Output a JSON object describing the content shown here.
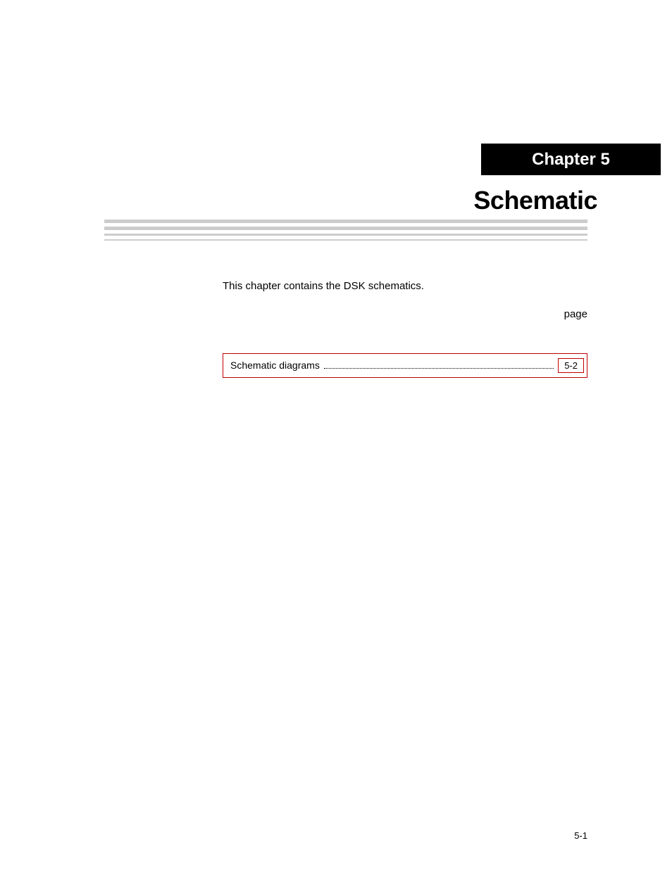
{
  "chapter": {
    "tab_label": "Chapter 5",
    "title": "Schematic"
  },
  "intro": {
    "line1": "This chapter contains the DSK schematics.",
    "line2_prefix": "Schematic diagrams . . . . . . . . . . . . . . . . . . . . . . . . . . . . . . . . . . . . . . . . . . . . . . . . . . . . .",
    "line2_page_heading": "page"
  },
  "toc": {
    "item_label": "Schematic diagrams",
    "item_page": "5-2"
  },
  "footer": {
    "page_number": "5-1"
  }
}
